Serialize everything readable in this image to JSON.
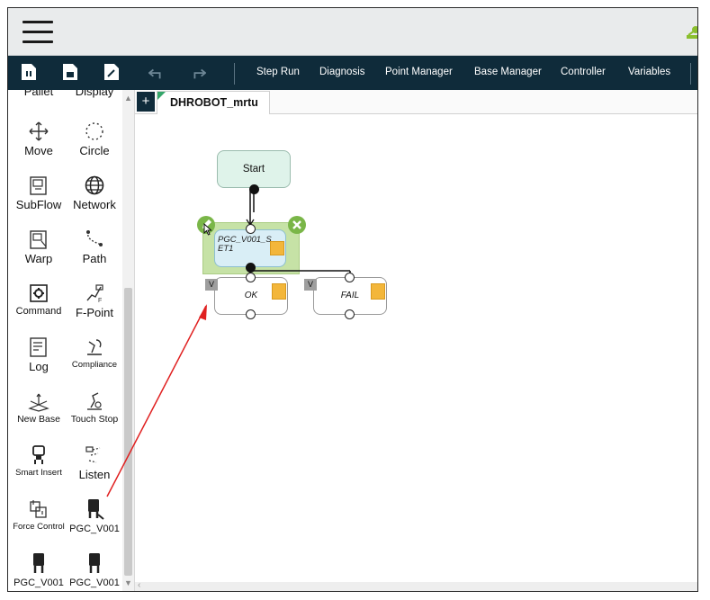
{
  "toolbar": {
    "menu": [
      "Step Run",
      "Diagnosis",
      "Point Manager",
      "Base Manager",
      "Controller",
      "Variables"
    ]
  },
  "sidebar": {
    "tools": [
      {
        "name": "pallet",
        "label": "Pallet",
        "icon": "pallet-icon"
      },
      {
        "name": "display",
        "label": "Display",
        "icon": "display-icon"
      },
      {
        "name": "move",
        "label": "Move",
        "icon": "move-icon"
      },
      {
        "name": "circle",
        "label": "Circle",
        "icon": "circle-icon"
      },
      {
        "name": "subflow",
        "label": "SubFlow",
        "icon": "subflow-icon"
      },
      {
        "name": "network",
        "label": "Network",
        "icon": "network-icon"
      },
      {
        "name": "warp",
        "label": "Warp",
        "icon": "warp-icon"
      },
      {
        "name": "path",
        "label": "Path",
        "icon": "path-icon"
      },
      {
        "name": "command",
        "label": "Command",
        "icon": "command-icon"
      },
      {
        "name": "f-point",
        "label": "F-Point",
        "icon": "f-point-icon"
      },
      {
        "name": "log",
        "label": "Log",
        "icon": "log-icon"
      },
      {
        "name": "compliance",
        "label": "Compliance",
        "icon": "compliance-icon"
      },
      {
        "name": "new-base",
        "label": "New Base",
        "icon": "new-base-icon"
      },
      {
        "name": "touch-stop",
        "label": "Touch Stop",
        "icon": "touch-stop-icon"
      },
      {
        "name": "smart-insert",
        "label": "Smart Insert",
        "icon": "smart-insert-icon"
      },
      {
        "name": "listen",
        "label": "Listen",
        "icon": "listen-icon"
      },
      {
        "name": "force-control",
        "label": "Force Control",
        "icon": "force-control-icon"
      },
      {
        "name": "pgc-v001-a",
        "label": "PGC_V001",
        "icon": "gripper-icon"
      },
      {
        "name": "pgc-v001-b",
        "label": "PGC_V001",
        "icon": "gripper-icon"
      },
      {
        "name": "pgc-v001-c",
        "label": "PGC_V001",
        "icon": "gripper-icon"
      }
    ]
  },
  "tabs": {
    "active": "DHROBOT_mrtu",
    "add_label": "+"
  },
  "flow": {
    "start": "Start",
    "function_node": "PGC_V001_SET1",
    "ok": "OK",
    "fail": "FAIL",
    "v_badge": "V"
  },
  "colors": {
    "toolbar_bg": "#0f2b3a",
    "start_fill": "#dff3ea",
    "selected_fill": "#c6e2a6",
    "selected_accent": "#7ab648",
    "arrow": "#e02020",
    "badge_orange": "#f3b63a"
  }
}
